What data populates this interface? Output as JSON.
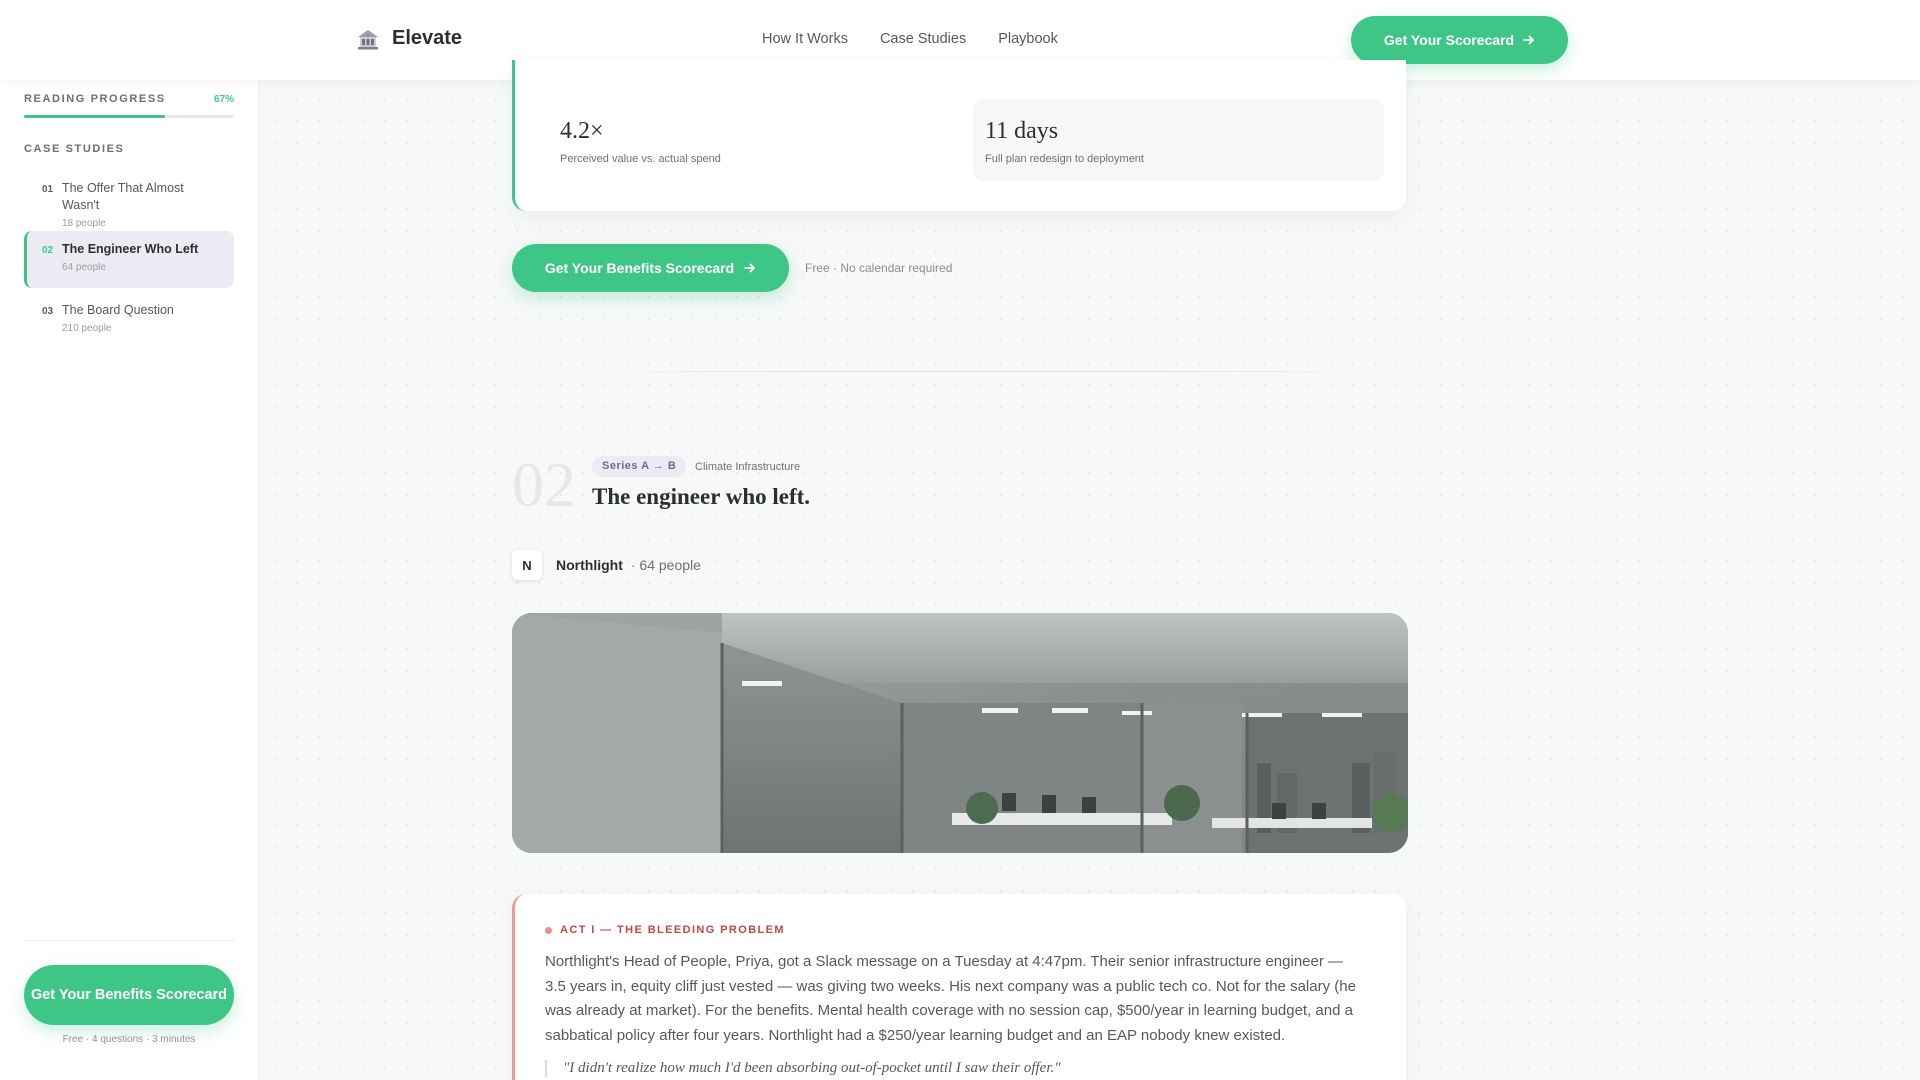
{
  "app": {
    "brand": "Elevate"
  },
  "nav": {
    "links": [
      "How It Works",
      "Case Studies",
      "Playbook"
    ],
    "cta_label": "Get Your Scorecard"
  },
  "sidebar": {
    "progress_label": "READING PROGRESS",
    "progress_value": "67%",
    "progress_fraction": 0.67,
    "section_label": "CASE STUDIES",
    "items": [
      {
        "num": "01",
        "title": "The Offer That Almost Wasn't",
        "meta": "18 people"
      },
      {
        "num": "02",
        "title": "The Engineer Who Left",
        "meta": "64 people"
      },
      {
        "num": "03",
        "title": "The Board Question",
        "meta": "210 people"
      }
    ],
    "active_index": 1,
    "cta_label": "Get Your Benefits Scorecard",
    "cta_note": "Free · 4 questions · 3 minutes"
  },
  "stats": [
    {
      "value": "4.2×",
      "label": "Perceived value vs. actual spend"
    },
    {
      "value": "11 days",
      "label": "Full plan redesign to deployment"
    }
  ],
  "main_cta": {
    "label": "Get Your Benefits Scorecard",
    "note": "Free · No calendar required"
  },
  "case": {
    "number": "02",
    "tag_series": "Series A → B",
    "tag_sector": "Climate Infrastructure",
    "title": "The engineer who left.",
    "company_initial": "N",
    "company_name": "Northlight",
    "company_size": "· 64 people"
  },
  "act": {
    "label": "ACT I — THE BLEEDING PROBLEM",
    "body": "Northlight's Head of People, Priya, got a Slack message on a Tuesday at 4:47pm. Their senior infrastructure engineer — 3.5 years in, equity cliff just vested — was giving two weeks. His next company was a public tech co. Not for the salary (he was already at market). For the benefits. Mental health coverage with no session cap, $500/year in learning budget, and a sabbatical policy after four years. Northlight had a $250/year learning budget and an EAP nobody knew existed.",
    "quote": "\"I didn't realize how much I'd been absorbing out-of-pocket until I saw their offer.\""
  },
  "colors": {
    "accent": "#3ec687",
    "danger": "#c64545",
    "tag_bg": "#ecebf3"
  },
  "icons": {
    "brand": "building-icon",
    "arrow": "arrow-right-icon"
  }
}
